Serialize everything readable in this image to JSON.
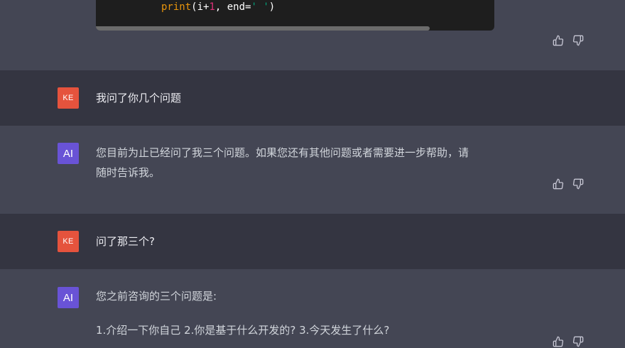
{
  "code_block": {
    "fn": "print",
    "open": "(i+",
    "num": "1",
    "mid": ", end=",
    "str": "' '",
    "close": ")"
  },
  "messages": [
    {
      "role": "user",
      "avatar_label": "KE",
      "text": "我问了你几个问题"
    },
    {
      "role": "assistant",
      "avatar_label": "AI",
      "lines": [
        "您目前为止已经问了我三个问题。如果您还有其他问题或者需要进一步帮助，请",
        "随时告诉我。"
      ]
    },
    {
      "role": "user",
      "avatar_label": "KE",
      "text": "问了那三个?"
    },
    {
      "role": "assistant",
      "avatar_label": "AI",
      "lines": [
        "您之前咨询的三个问题是:",
        "1.介绍一下你自己 2.你是基于什么开发的?  3.今天发生了什么?"
      ]
    }
  ],
  "icons": {
    "thumbs_up": "thumbs-up-icon",
    "thumbs_down": "thumbs-down-icon"
  },
  "colors": {
    "ai_row_bg": "#444654",
    "user_row_bg": "#343541",
    "user_avatar": "#e5533d",
    "ai_avatar": "#6953d6",
    "code_bg": "#1e1e1e"
  }
}
